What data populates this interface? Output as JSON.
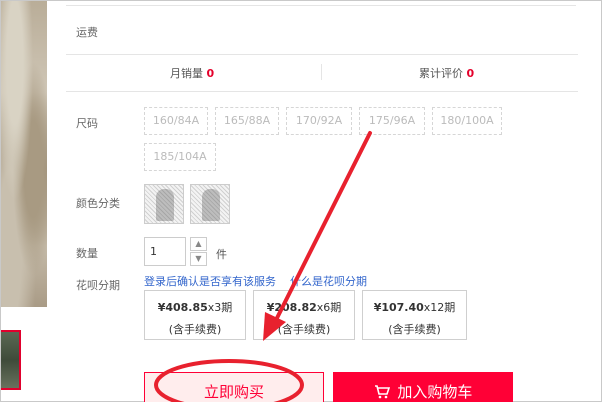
{
  "product": {
    "shipping_label": "运费",
    "stats": {
      "monthly_sales_label": "月销量",
      "monthly_sales_value": "0",
      "cumulative_reviews_label": "累计评价",
      "cumulative_reviews_value": "0"
    },
    "size": {
      "label": "尺码",
      "options": [
        "160/84A",
        "165/88A",
        "170/92A",
        "175/96A",
        "180/100A",
        "185/104A"
      ]
    },
    "color": {
      "label": "颜色分类",
      "swatches": [
        "color-swatch-1",
        "color-swatch-2"
      ]
    },
    "quantity": {
      "label": "数量",
      "value": "1",
      "unit": "件",
      "increment_icon": "chevron-up-icon",
      "decrement_icon": "chevron-down-icon"
    },
    "installment": {
      "label": "花呗分期",
      "notice": "登录后确认是否享有该服务",
      "link": "什么是花呗分期",
      "plans": [
        {
          "amount": "¥408.85",
          "period": "x3期",
          "fee": "(含手续费)"
        },
        {
          "amount": "¥208.82",
          "period": "x6期",
          "fee": "(含手续费)"
        },
        {
          "amount": "¥107.40",
          "period": "x12期",
          "fee": "(含手续费)"
        }
      ]
    },
    "actions": {
      "buy_now": "立即购买",
      "add_to_cart": "加入购物车",
      "cart_icon": "cart-icon"
    }
  },
  "annotation": {
    "color": "#e8212e",
    "arrow_icon": "arrow-annotation",
    "ellipse_icon": "circle-annotation"
  }
}
